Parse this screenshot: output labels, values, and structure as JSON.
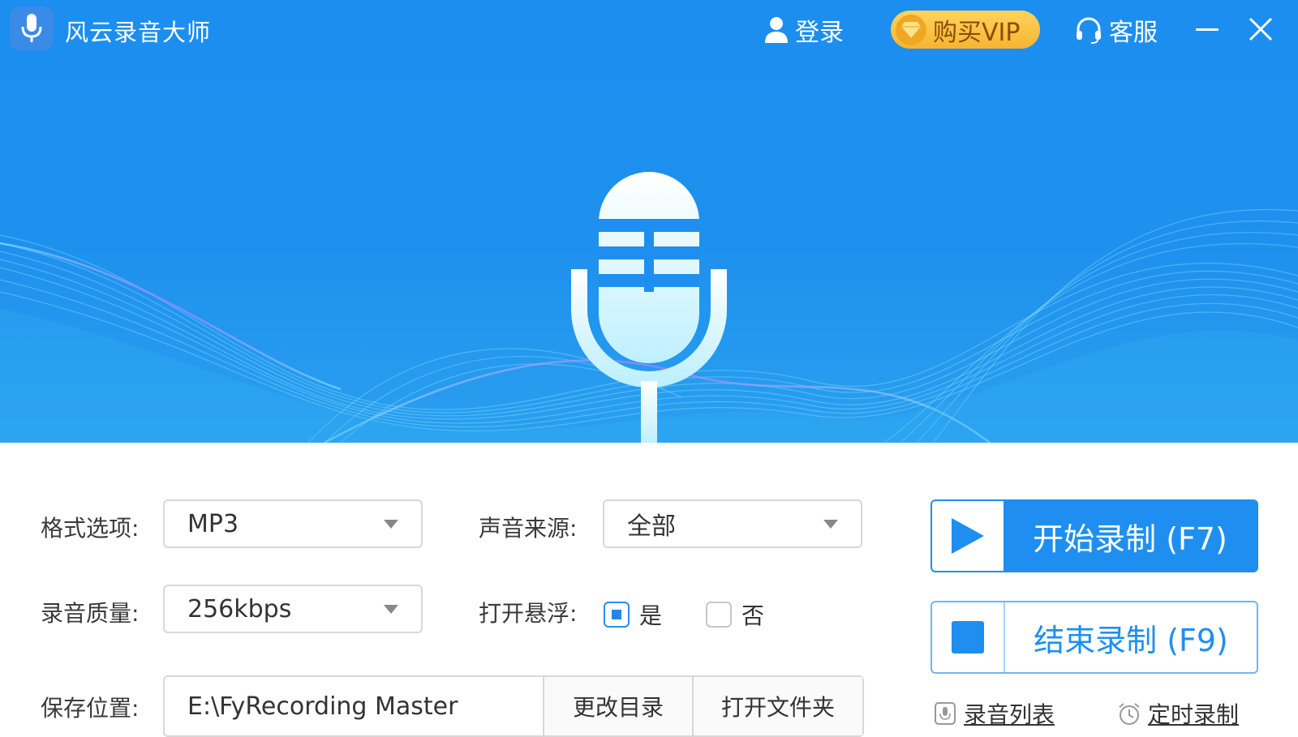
{
  "app": {
    "title": "风云录音大师"
  },
  "topbar": {
    "login_label": "登录",
    "vip_label": "购买VIP",
    "service_label": "客服"
  },
  "settings": {
    "format_label": "格式选项:",
    "format_value": "MP3",
    "source_label": "声音来源:",
    "source_value": "全部",
    "quality_label": "录音质量:",
    "quality_value": "256kbps",
    "floating_label": "打开悬浮:",
    "floating_yes": "是",
    "floating_no": "否",
    "floating_selected": "是",
    "save_label": "保存位置:",
    "save_path": "E:\\FyRecording Master",
    "change_dir_label": "更改目录",
    "open_folder_label": "打开文件夹"
  },
  "actions": {
    "start_label": "开始录制 (F7)",
    "stop_label": "结束录制 (F9)",
    "list_label": "录音列表",
    "timer_label": "定时录制"
  },
  "colors": {
    "primary": "#1e8ff0",
    "vip_gold": "#f5b532",
    "wave_cyan": "#7fe0ff",
    "wave_purple": "#b06cf0"
  }
}
